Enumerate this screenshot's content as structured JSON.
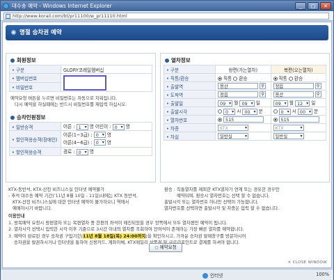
{
  "window": {
    "title": "대수송 예약 - Windows Internet Explorer",
    "url": "http://www.korail.com/bt/pr11100/w_pr11110.html"
  },
  "header": {
    "title": "명절 승차권 예약"
  },
  "member": {
    "title": "회원정보",
    "rows": [
      {
        "label": "구분",
        "value": "GLORY코레일멤버십"
      },
      {
        "label": "멤버십번호",
        "value": ""
      },
      {
        "label": "비밀번호",
        "value": ""
      }
    ],
    "notes": [
      "예약요청 버튼을 누르면 비밀번호는 자동으로 지워집니다.",
      "다시 예약을 하실때에는 반드시 비밀번호를 재입력 하십시오."
    ]
  },
  "passenger": {
    "title": "승차인원정보",
    "rows": [
      {
        "label": "일반승객",
        "a_label": "어른 :",
        "a_val": "1",
        "a_unit": "명",
        "b_label": "어린이 :",
        "b_val": "0",
        "b_unit": "명"
      },
      {
        "label": "할인적용승객(장애인)",
        "a_label": "어른(1~3급) :",
        "a_val": "0",
        "a_unit": "명",
        "b2_label": "어른(4~6급) :",
        "b2_val": "0",
        "b2_unit": "명"
      },
      {
        "label": "할인적용승객",
        "a_label": "경로 :",
        "a_val": "0",
        "a_unit": "명"
      }
    ],
    "notes": [
      "KTX-동반석, KTX-산천 비즈니스실 인터넷 예약불가",
      "- 추석 대수송 예약 기간('11년 8월 10일 - 11일)내에는 KTX 동반석,",
      "KTX-산천 비즈니스실에 대한 인터넷 예약이 불가하오니 역에서",
      "예매하시기 바랍니다."
    ]
  },
  "train": {
    "title": "열차정보",
    "col_go": "왕편(가는열차)",
    "col_back": "복편(오는열차)",
    "type_label": "구분",
    "direct_label": "직통/환승",
    "direct_opt": "직통",
    "transfer_opt": "환승",
    "dep_label": "출발역",
    "dep_go": "용산",
    "dep_back": "정읍",
    "arr_label": "도착역",
    "arr_go": "정읍",
    "arr_back": "용산",
    "date_label": "출발일",
    "date_go": {
      "m": "09",
      "m_unit": "월",
      "d": "09",
      "d_unit": "일"
    },
    "date_back": {
      "m": "09",
      "m_unit": "월",
      "d": "12",
      "d_unit": "일"
    },
    "time_label": "출발시각",
    "time_go": {
      "h": "0",
      "h_unit": "시",
      "m": "00",
      "m_unit": "분"
    },
    "time_back": {
      "h": "0",
      "h_unit": "시",
      "m": "00",
      "m_unit": "분"
    },
    "trainno_label": "열차번호",
    "trainno_go": "515",
    "trainno_back": "515",
    "kind_label": "차종",
    "kind_go": "KTX",
    "kind_back": "KTX",
    "seat_label": "차실",
    "seat_go": "일반실",
    "seat_back": "일반실",
    "notes": [
      "환승 : 직통열차를 제외한 KTX열차가 연계 또는 경유한 경우만",
      "예약되며, 환승시 열차번호는 선택 할 수 없습니다.",
      "출발시각 또는 열차번호 하나만 선택이 가능합니다.",
      "열차번호를 선택하면 출발시각 및 차종은 입력 할 수 없습니다."
    ]
  },
  "guide": {
    "title": "이용안내",
    "lines": [
      "1. 왕복예약 요청시 왕편열차 또는 복편열차 중 한편의 좌석이 매진되었을 경우 양쪽에서 모두 열차편만 예약이 됩니다.",
      "2. 열차시각 선택시 입력한 시각 이후 기준으로 3시간 이내의 열차를 조회하여 잔여석이 존재하는 가장 빠른 열차를 예약합니다.",
      "3. 예약이 완료된 경우 승차권 구입기한(",
      "11년 8월 18일(목) 24:00까지",
      ")을 확인하시고, 가까운 승차권 발매창구를 방문하시어",
      "승차권을 발권하시거나 인터넷을 통하여 신용카드, 계좌이체, KTX매일리 상품권 및 글로리포인트로 결제를 하셔야 합니다."
    ]
  },
  "buttons": {
    "reserve": "예약요청",
    "close": "CLOSE WINDOW"
  },
  "statusbar": {
    "zone": "인터넷",
    "zoom": "100%"
  }
}
